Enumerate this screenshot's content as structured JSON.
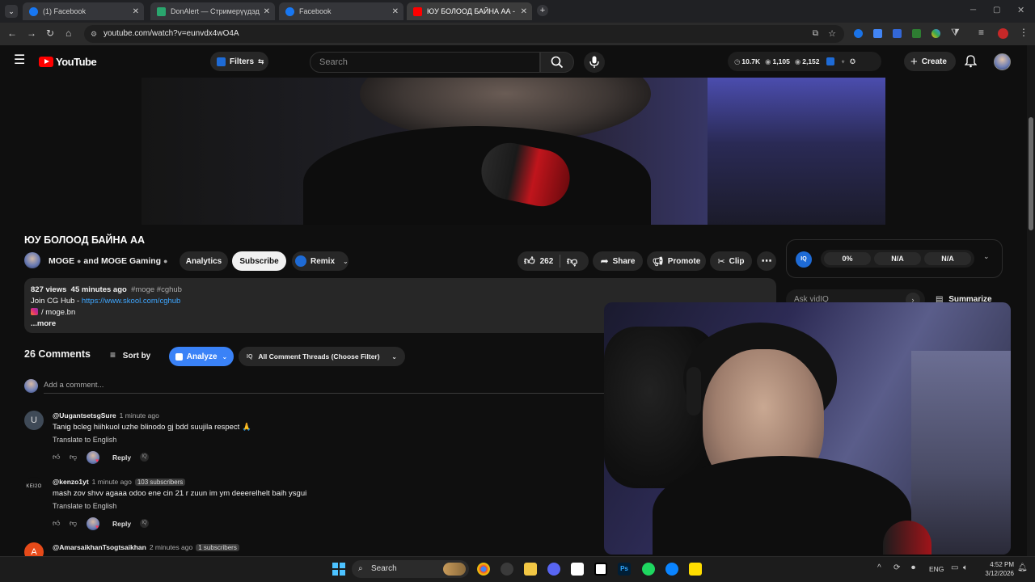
{
  "browser": {
    "tabs": [
      {
        "title": "(1) Facebook",
        "color": "#1877f2"
      },
      {
        "title": "DonAlert — Стримерүүдэд зор",
        "color": "#2aa66e"
      },
      {
        "title": "Facebook",
        "color": "#1877f2"
      },
      {
        "title": "ЮУ БОЛООД БАЙНА АА - You",
        "color": "#ff0000"
      }
    ],
    "url": "youtube.com/watch?v=eunvdx4wO4A"
  },
  "yt_header": {
    "logo_text": "YouTube",
    "filters_label": "Filters",
    "search_placeholder": "Search",
    "stats": {
      "subs": "10.7K",
      "views": "1,105",
      "other": "2,152"
    },
    "create_label": "Create"
  },
  "video": {
    "title": "ЮУ БОЛООД БАЙНА АА",
    "channel": "MOGE",
    "channel_and": "and",
    "channel2": "MOGE Gaming",
    "analytics_label": "Analytics",
    "subscribe_label": "Subscribe",
    "remix_label": "Remix",
    "like_count": "262",
    "share_label": "Share",
    "promote_label": "Promote",
    "clip_label": "Clip"
  },
  "vidiq_panel": {
    "score_a": "0%",
    "score_b": "N/A",
    "score_c": "N/A",
    "ask_placeholder": "Ask vidIQ",
    "summarize_label": "Summarize"
  },
  "description": {
    "views": "827 views",
    "time": "45 minutes ago",
    "tags": "#moge #cghub",
    "line1_prefix": "Join CG Hub - ",
    "line1_link": "https://www.skool.com/cghub",
    "line2": "/ moge.bn",
    "more": "...more"
  },
  "comments_header": {
    "count": "26 Comments",
    "sort_label": "Sort by",
    "analyze_label": "Analyze",
    "filter_label": "All Comment Threads (Choose Filter)",
    "add_placeholder": "Add a comment..."
  },
  "comments": [
    {
      "avatar_letter": "U",
      "avatar_color": "#3f4a57",
      "author": "@UugantsetsgSure",
      "time": "1 minute ago",
      "badge": "",
      "text": "Tanig bcleg hiihkuol uzhe blinodo gj bdd suujila respect 🙏",
      "translate": "Translate to English",
      "reply": "Reply"
    },
    {
      "avatar_letter": "KEI2O",
      "avatar_color": "#0f0f0f",
      "author": "@kenzo1yt",
      "time": "1 minute ago",
      "badge": "103 subscribers",
      "text": "mash zov shvv agaaa odoo ene cin 21 r zuun im ym deeerelhelt baih ysgui",
      "translate": "Translate to English",
      "reply": "Reply"
    },
    {
      "avatar_letter": "A",
      "avatar_color": "#e64a19",
      "author": "@AmarsaikhanTsogtsaikhan",
      "time": "2 minutes ago",
      "badge": "1 subscribers",
      "text": "",
      "translate": "",
      "reply": ""
    }
  ],
  "taskbar": {
    "search_label": "Search",
    "lang": "ENG",
    "time": "4:52 PM",
    "date": "3/12/2026"
  }
}
